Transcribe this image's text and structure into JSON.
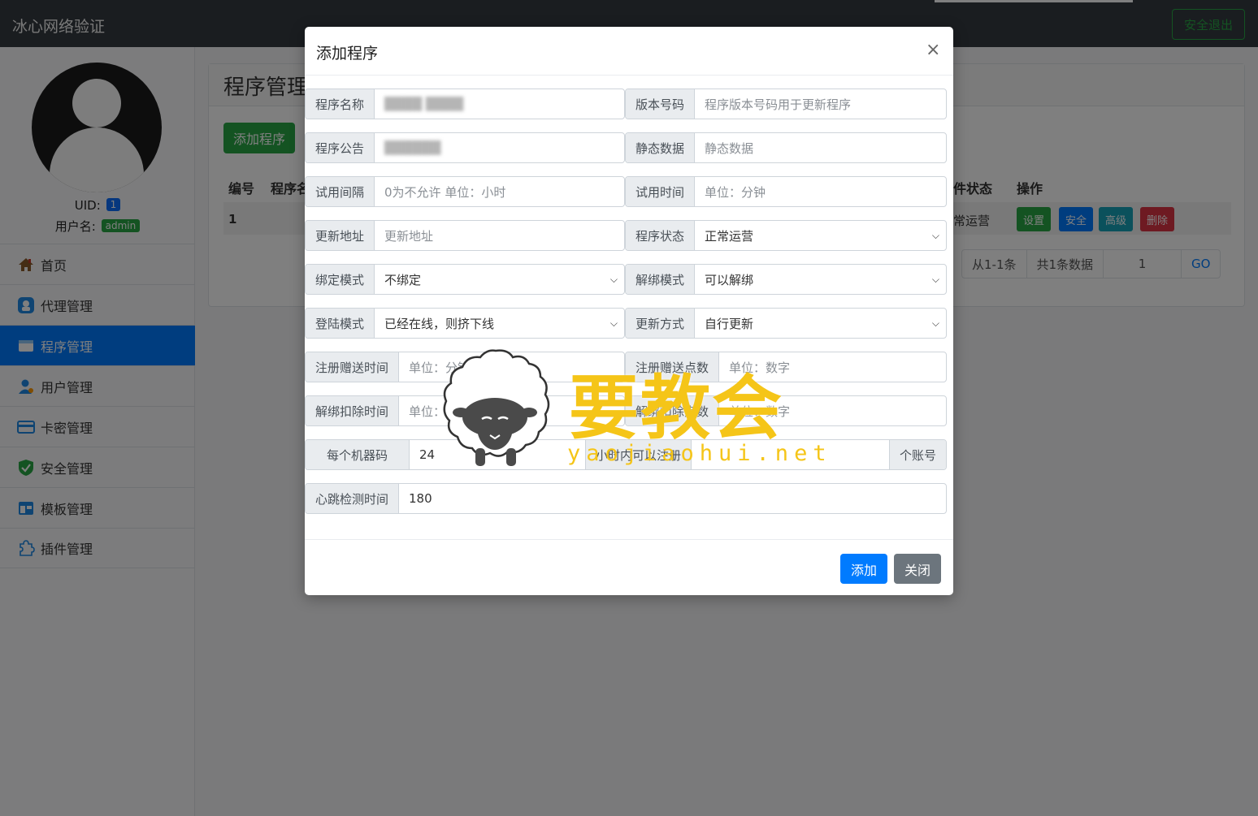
{
  "navbar": {
    "brand": "冰心网络验证",
    "logout_label": "安全退出"
  },
  "sidebar": {
    "uid_label": "UID:",
    "uid_value": "1",
    "username_label": "用户名:",
    "username_value": "admin",
    "items": [
      {
        "label": "首页",
        "icon": "home-icon"
      },
      {
        "label": "代理管理",
        "icon": "agent-icon"
      },
      {
        "label": "程序管理",
        "icon": "program-icon",
        "active": true
      },
      {
        "label": "用户管理",
        "icon": "user-icon"
      },
      {
        "label": "卡密管理",
        "icon": "card-icon"
      },
      {
        "label": "安全管理",
        "icon": "shield-icon"
      },
      {
        "label": "模板管理",
        "icon": "template-icon"
      },
      {
        "label": "插件管理",
        "icon": "plugin-icon"
      }
    ]
  },
  "main": {
    "title": "程序管理",
    "add_button": "添加程序",
    "table": {
      "headers": [
        "编号",
        "程序名",
        "件状态",
        "操作"
      ],
      "rows": [
        {
          "id": "1",
          "status": "常运营"
        }
      ],
      "actions": [
        "设置",
        "安全",
        "高级",
        "删除"
      ]
    },
    "pager": [
      "从1-1条",
      "共1条数据",
      "1",
      "GO"
    ]
  },
  "modal": {
    "title": "添加程序",
    "close": "×",
    "fields": {
      "program_name": {
        "label": "程序名称",
        "value": "████ ████"
      },
      "version": {
        "label": "版本号码",
        "placeholder": "程序版本号码用于更新程序"
      },
      "notice": {
        "label": "程序公告",
        "value": "██████"
      },
      "static_data": {
        "label": "静态数据",
        "placeholder": "静态数据"
      },
      "trial_interval": {
        "label": "试用间隔",
        "placeholder": "0为不允许 单位：小时"
      },
      "trial_time": {
        "label": "试用时间",
        "placeholder": "单位：分钟"
      },
      "update_url": {
        "label": "更新地址",
        "placeholder": "更新地址"
      },
      "program_status": {
        "label": "程序状态",
        "value": "正常运营"
      },
      "bind_mode": {
        "label": "绑定模式",
        "value": "不绑定"
      },
      "unbind_mode": {
        "label": "解绑模式",
        "value": "可以解绑"
      },
      "login_mode": {
        "label": "登陆模式",
        "value": "已经在线，则挤下线"
      },
      "update_method": {
        "label": "更新方式",
        "value": "自行更新"
      },
      "reg_gift_time": {
        "label": "注册赠送时间",
        "placeholder": "单位：分钟"
      },
      "reg_gift_count": {
        "label": "注册赠送点数",
        "placeholder": "单位：数字"
      },
      "unbind_deduct_time": {
        "label": "解绑扣除时间",
        "placeholder": "单位：分钟"
      },
      "unbind_deduct_count": {
        "label": "解绑扣除点数",
        "placeholder": "单位：数字"
      },
      "per_machine": {
        "label": "每个机器码",
        "value": "24",
        "middle": "小时内可以注册",
        "suffix": "个账号"
      },
      "heartbeat": {
        "label": "心跳检测时间",
        "value": "180"
      }
    },
    "submit": "添加",
    "cancel": "关闭"
  },
  "watermark": {
    "text": "要教会",
    "url": "yaojiaohui.net"
  },
  "colors": {
    "primary": "#007bff",
    "success": "#28a745",
    "info": "#17a2b8",
    "danger": "#dc3545",
    "navbar": "#343a40",
    "watermark": "#f5c518"
  }
}
